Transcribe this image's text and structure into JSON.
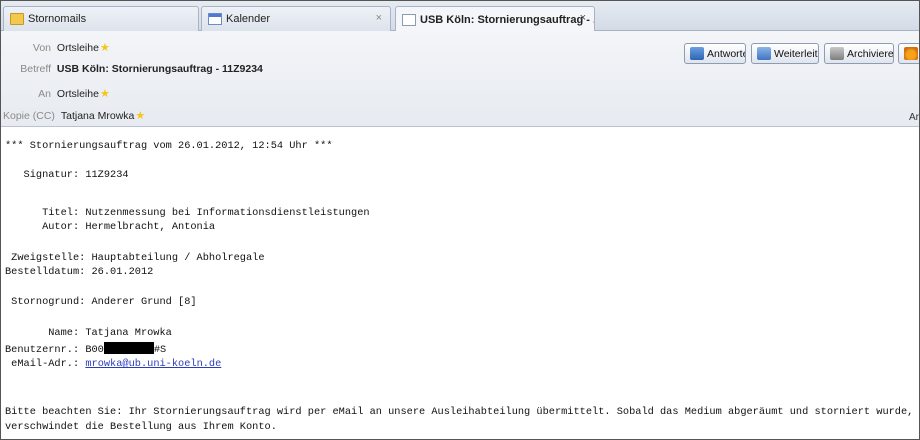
{
  "tabs": [
    {
      "label": "Stornomails",
      "icon": "folder-icon"
    },
    {
      "label": "Kalender",
      "icon": "calendar-icon",
      "close": "×"
    },
    {
      "label": "USB Köln: Stornierungsauftrag - ...",
      "icon": "mail-icon",
      "close": "×",
      "active": true
    }
  ],
  "header": {
    "from_label": "Von",
    "from_value": "Ortsleihe",
    "subject_label": "Betreff",
    "subject_value": "USB Köln: Stornierungsauftrag - 11Z9234",
    "to_label": "An",
    "to_value": "Ortsleihe",
    "cc_label": "Kopie (CC)",
    "cc_value": "Tatjana Mrowka",
    "more_label": "Ar"
  },
  "toolbar": {
    "reply_label": "Antworten",
    "forward_label": "Weiterleiten",
    "archive_label": "Archivieren",
    "junk_label": "Ju"
  },
  "message": {
    "heading": "*** Stornierungsauftrag vom 26.01.2012, 12:54 Uhr ***",
    "signatur": "   Signatur: 11Z9234",
    "titel": "      Titel: Nutzenmessung bei Informationsdienstleistungen",
    "autor": "      Autor: Hermelbracht, Antonia",
    "zweigstelle": " Zweigstelle: Hauptabteilung / Abholregale",
    "bestelldatum": "Bestelldatum: 26.01.2012",
    "stornogrund": " Stornogrund: Anderer Grund [8]",
    "name": "       Name: Tatjana Mrowka",
    "benutzernr_prefix": "Benutzernr.: B00",
    "benutzernr_suffix": "#S",
    "email_label": " eMail-Adr.: ",
    "email_value": "mrowka@ub.uni-koeln.de",
    "footer_line1": "Bitte beachten Sie: Ihr Stornierungsauftrag wird per eMail an unsere Ausleihabteilung übermittelt. Sobald das Medium abgeräumt und storniert wurde,",
    "footer_line2": "verschwindet die Bestellung aus Ihrem Konto."
  }
}
